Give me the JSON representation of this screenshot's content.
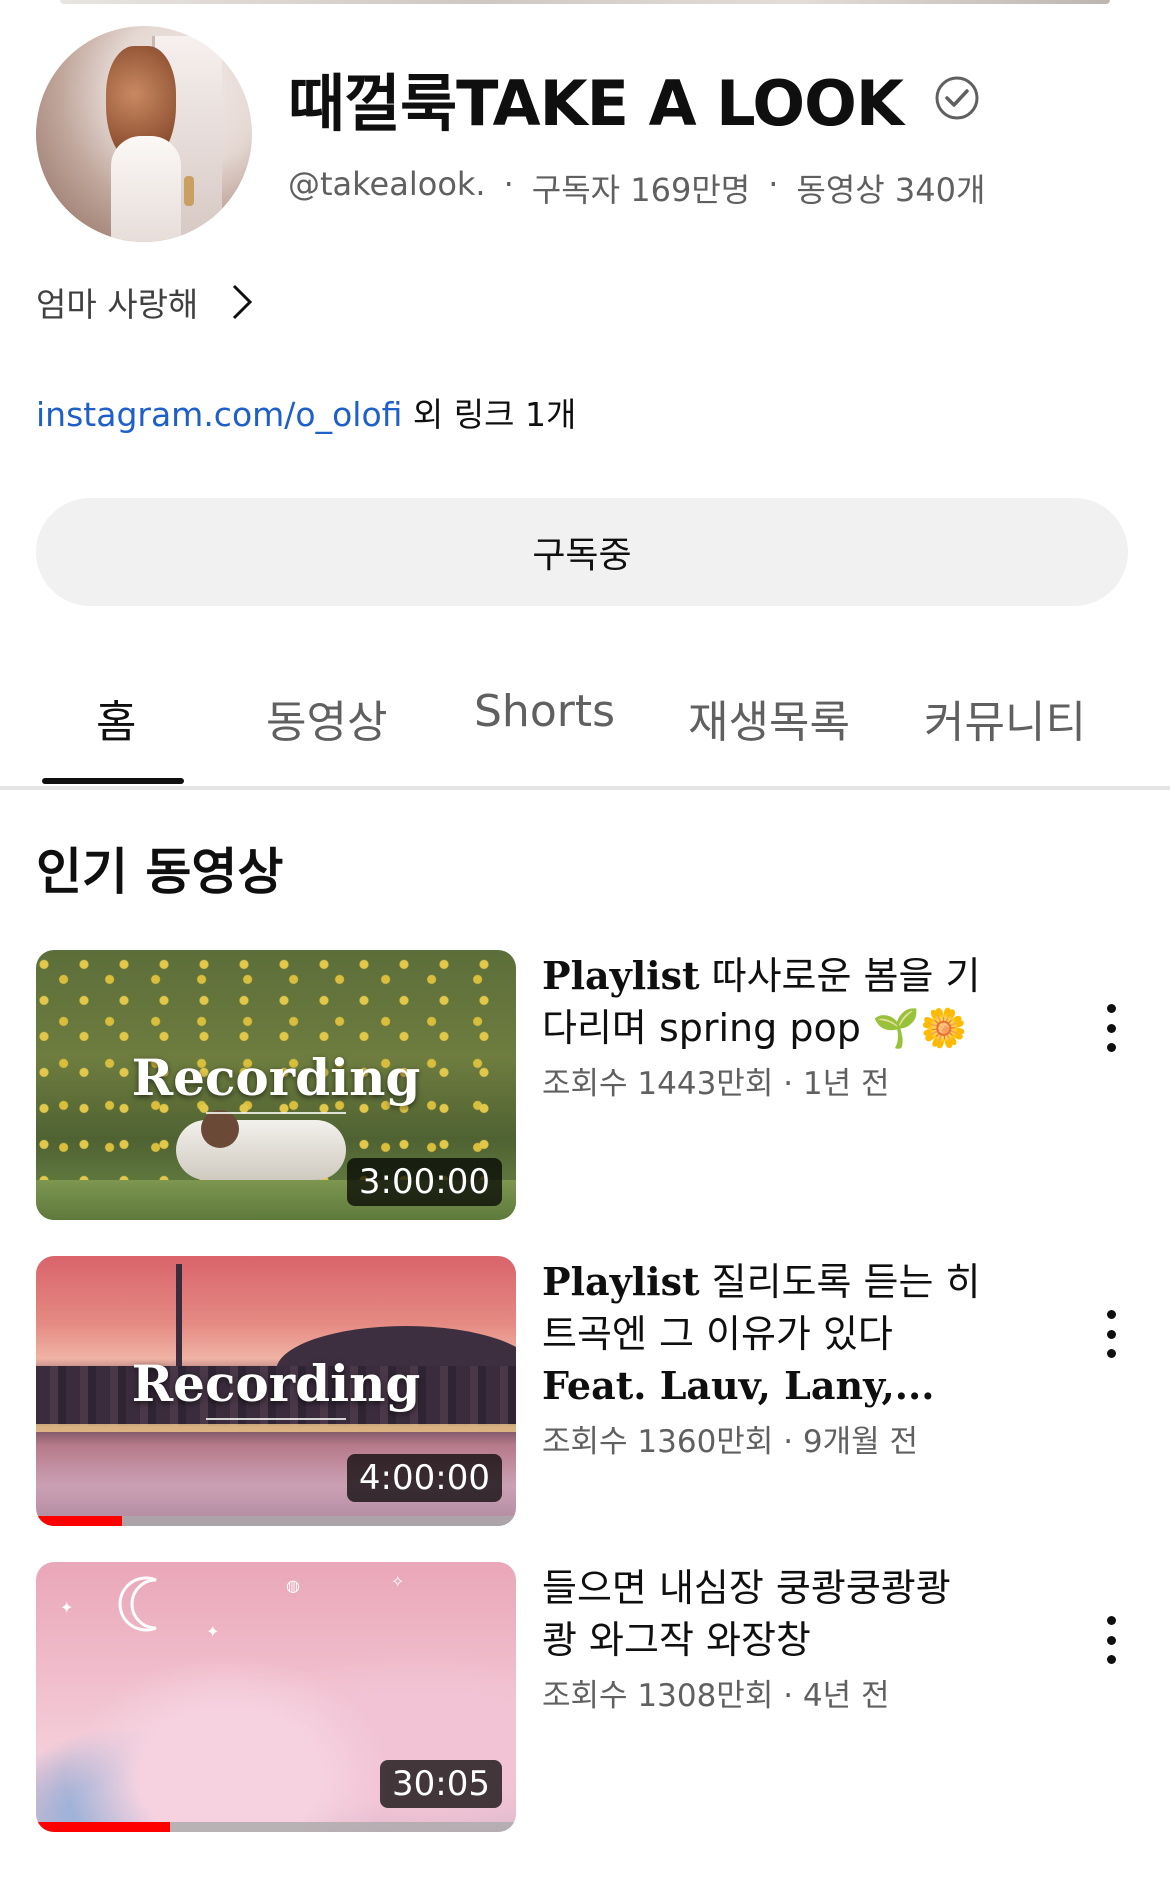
{
  "channel": {
    "name": "때껄룩TAKE A LOOK",
    "handle": "@takealook.",
    "subscribers": "구독자 169만명",
    "video_count": "동영상 340개",
    "description": "엄마 사랑해",
    "link_url": "instagram.com/o_olofi",
    "link_more": " 외 링크 1개",
    "subscribe_label": "구독중"
  },
  "tabs": [
    "홈",
    "동영상",
    "Shorts",
    "재생목록",
    "커뮤니티"
  ],
  "active_tab": "홈",
  "section_title": "인기 동영상",
  "videos": [
    {
      "title_serif": "Playlist",
      "title_rest": " 따사로운 봄을 기다리며 spring pop 🌱🌼",
      "views_time": "조회수 1443만회 · 1년 전",
      "duration": "3:00:00",
      "overlay": "Recording",
      "progress": 0
    },
    {
      "title_serif": "Playlist",
      "title_rest": " 질리도록 듣는 히트곡엔 그 이유가 있다 ",
      "title_serif2": "Feat. Lauv, Lany,...",
      "views_time": "조회수 1360만회 · 9개월 전",
      "duration": "4:00:00",
      "overlay": "Recording",
      "progress": 0.18
    },
    {
      "title_rest": "들으면 내심장 쿵쾅쿵쾅쾅 쾅 와그작 와장창",
      "views_time": "조회수 1308만회 · 4년 전",
      "duration": "30:05",
      "progress": 0.28
    }
  ],
  "colors": {
    "link": "#1f5fc9",
    "secondary_text": "#606060",
    "progress_red": "#ff0000",
    "button_bg": "#f1f1f1"
  },
  "icons": {
    "verified": "check-circle-icon",
    "description_more": "chevron-right-icon",
    "video_menu": "more-vert-icon"
  }
}
